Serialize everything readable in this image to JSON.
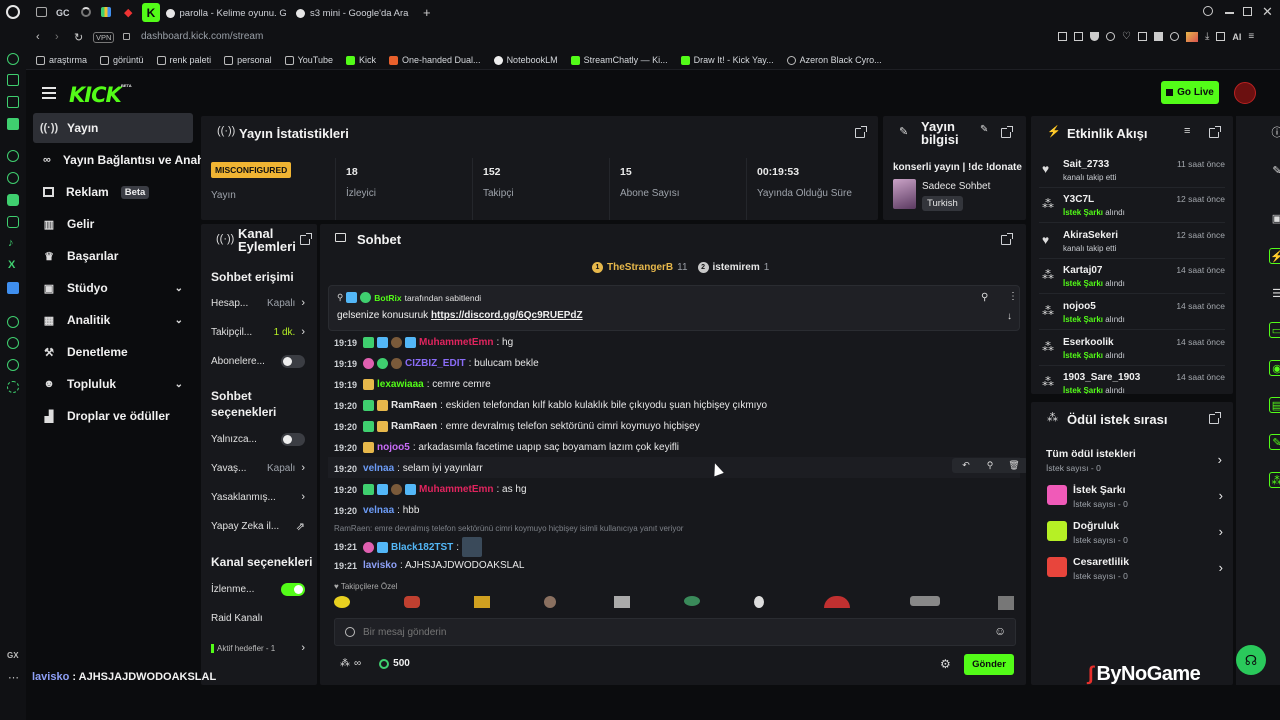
{
  "browser": {
    "tabs": [
      {
        "label": "GC"
      },
      {
        "label": "parolla - Kelime oyunu. Gü"
      },
      {
        "label": "s3 mini - Google'da Ara"
      }
    ],
    "url": "dashboard.kick.com/stream",
    "vpn_label": "VPN",
    "ai_label": "AI",
    "bookmarks": [
      "araştırma",
      "görüntü",
      "renk paleti",
      "personal",
      "YouTube",
      "Kick",
      "One-handed Dual...",
      "NotebookLM",
      "StreamChatly — Ki...",
      "Draw It! - Kick Yay...",
      "Azeron Black Cyro..."
    ]
  },
  "header": {
    "logo": "KICK",
    "logo_badge": "BETA",
    "go_live": "Go Live"
  },
  "nav": {
    "items": [
      {
        "label": "Yayın",
        "icon": "broadcast-icon",
        "active": true
      },
      {
        "label": "Yayın Bağlantısı ve Anahtarı",
        "icon": "link-icon"
      },
      {
        "label": "Reklam",
        "icon": "ad-icon",
        "badge": "Beta"
      },
      {
        "label": "Gelir",
        "icon": "chart-icon"
      },
      {
        "label": "Başarılar",
        "icon": "trophy-icon"
      },
      {
        "label": "Stüdyo",
        "icon": "studio-icon",
        "chevron": true
      },
      {
        "label": "Analitik",
        "icon": "analytics-icon",
        "chevron": true
      },
      {
        "label": "Denetleme",
        "icon": "hammer-icon"
      },
      {
        "label": "Topluluk",
        "icon": "community-icon",
        "chevron": true
      },
      {
        "label": "Droplar ve ödüller",
        "icon": "drops-icon"
      }
    ]
  },
  "stats": {
    "title": "Yayın İstatistikleri",
    "status_badge": "MISCONFIGURED",
    "status_label": "Yayın",
    "items": [
      {
        "value": "18",
        "label": "İzleyici"
      },
      {
        "value": "152",
        "label": "Takipçi"
      },
      {
        "value": "15",
        "label": "Abone Sayısı"
      },
      {
        "value": "00:19:53",
        "label": "Yayında Olduğu Süre"
      }
    ]
  },
  "stream_info": {
    "title": "Yayın bilgisi",
    "stream_title": "konserli yayın | !dc !donate",
    "category": "Sadece Sohbet",
    "language": "Turkish"
  },
  "channel_actions": {
    "title": "Kanal Eylemleri",
    "chat_access": "Sohbet erişimi",
    "rows1": [
      {
        "label": "Hesap...",
        "value": "Kapalı",
        "type": "arrow"
      },
      {
        "label": "Takipçil...",
        "value": "1 dk.",
        "type": "arrow",
        "accent": true
      },
      {
        "label": "Abonelere...",
        "type": "toggle",
        "on": false
      }
    ],
    "chat_options": "Sohbet seçenekleri",
    "rows2": [
      {
        "label": "Yalnızca...",
        "type": "toggle",
        "on": false
      },
      {
        "label": "Yavaş...",
        "value": "Kapalı",
        "type": "arrow"
      },
      {
        "label": "Yasaklanmış...",
        "type": "arrow"
      },
      {
        "label": "Yapay Zeka il...",
        "type": "external"
      }
    ],
    "channel_options": "Kanal seçenekleri",
    "rows3": [
      {
        "label": "İzlenme...",
        "type": "toggle",
        "on": true
      },
      {
        "label": "Raid Kanalı",
        "type": "none"
      },
      {
        "label": "Aktif hedefler - 1",
        "type": "arrow"
      }
    ]
  },
  "chat": {
    "title": "Sohbet",
    "top_gifters": [
      {
        "rank": "1",
        "name": "TheStrangerB",
        "count": "11"
      },
      {
        "rank": "2",
        "name": "istemirem",
        "count": "1"
      }
    ],
    "pinned": {
      "by_user": "BotRix",
      "by_text": "tarafından sabitlendi",
      "text": "gelsenize konusuruk",
      "link": "https://discord.gg/6Qc9RUEPdZ"
    },
    "messages": [
      {
        "time": "19:19",
        "user": "MuhammetEmn",
        "color": "#e0245e",
        "text": ": hg"
      },
      {
        "time": "19:19",
        "user": "CIZBIZ_EDIT",
        "color": "#8a6cf7",
        "text": ": bulucam bekle"
      },
      {
        "time": "19:19",
        "user": "lexawiaaa",
        "color": "#53fc18",
        "text": ": cemre cemre"
      },
      {
        "time": "19:20",
        "user": "RamRaen",
        "color": "#f1f1f1",
        "text": ": eskiden telefondan kılf kablo kulaklık bile çıkıyodu şuan hiçbişey çıkmıyo"
      },
      {
        "time": "19:20",
        "user": "RamRaen",
        "color": "#f1f1f1",
        "text": ": emre devralmış telefon sektörünü cimri koymuyo hiçbişey"
      },
      {
        "time": "19:20",
        "user": "nojoo5",
        "color": "#c86cf7",
        "text": ": arkadasımla facetime uapıp saç boyamam lazım çok keyifli"
      },
      {
        "time": "19:20",
        "user": "velnaa",
        "color": "#6c9cf7",
        "text": ": selam iyi yayınlarr"
      },
      {
        "time": "19:20",
        "user": "MuhammetEmn",
        "color": "#e0245e",
        "text": ": as hg"
      },
      {
        "time": "19:20",
        "user": "velnaa",
        "color": "#6c9cf7",
        "text": ": hbb"
      },
      {
        "time": "19:21",
        "user": "Black182TST",
        "color": "#53b7f7",
        "text": ":"
      },
      {
        "time": "19:21",
        "user": "lavisko",
        "color": "#8ea0f7",
        "text": ": AJHSJAJDWODOAKSLAL"
      }
    ],
    "reply_hint": "RamRaen: emre devralmış telefon sektörünü cimri koymuyo hiçbişey isimli kullanıcıya yanıt veriyor",
    "followers_only": "Takipçilere Özel",
    "input_placeholder": "Bir mesaj gönderin",
    "points": "500",
    "send": "Gönder"
  },
  "activity": {
    "title": "Etkinlik Akışı",
    "events": [
      {
        "name": "Sait_2733",
        "sub": "kanalı takip etti",
        "time": "11 saat önce",
        "type": "follow"
      },
      {
        "name": "Y3C7L",
        "sub_b": "İstek Şarkı",
        "sub": " alındı",
        "time": "12 saat önce",
        "type": "reward"
      },
      {
        "name": "AkiraSekeri",
        "sub": "kanalı takip etti",
        "time": "12 saat önce",
        "type": "follow"
      },
      {
        "name": "Kartaj07",
        "sub_b": "İstek Şarkı",
        "sub": " alındı",
        "time": "14 saat önce",
        "type": "reward"
      },
      {
        "name": "nojoo5",
        "sub_b": "İstek Şarkı",
        "sub": " alındı",
        "time": "14 saat önce",
        "type": "reward"
      },
      {
        "name": "Eserkoolik",
        "sub_b": "İstek Şarkı",
        "sub": " alındı",
        "time": "14 saat önce",
        "type": "reward"
      },
      {
        "name": "1903_Sare_1903",
        "sub_b": "İstek Şarkı",
        "sub": " alındı",
        "time": "14 saat önce",
        "type": "reward"
      }
    ]
  },
  "rewards": {
    "title": "Ödül istek sırası",
    "items": [
      {
        "name": "Tüm ödül istekleri",
        "sub": "İstek sayısı - 0",
        "color": ""
      },
      {
        "name": "İstek Şarkı",
        "sub": "İstek sayısı - 0",
        "color": "#f05ab8"
      },
      {
        "name": "Doğruluk",
        "sub": "İstek sayısı - 0",
        "color": "#b6f025"
      },
      {
        "name": "Cesaretlilik",
        "sub": "İstek sayısı - 0",
        "color": "#e8453c"
      }
    ]
  },
  "footer": {
    "gx": "GX",
    "ticker_user": "lavisko",
    "ticker_text": " : AJHSJAJDWODOAKSLAL",
    "watermark": "ByNoGame"
  }
}
